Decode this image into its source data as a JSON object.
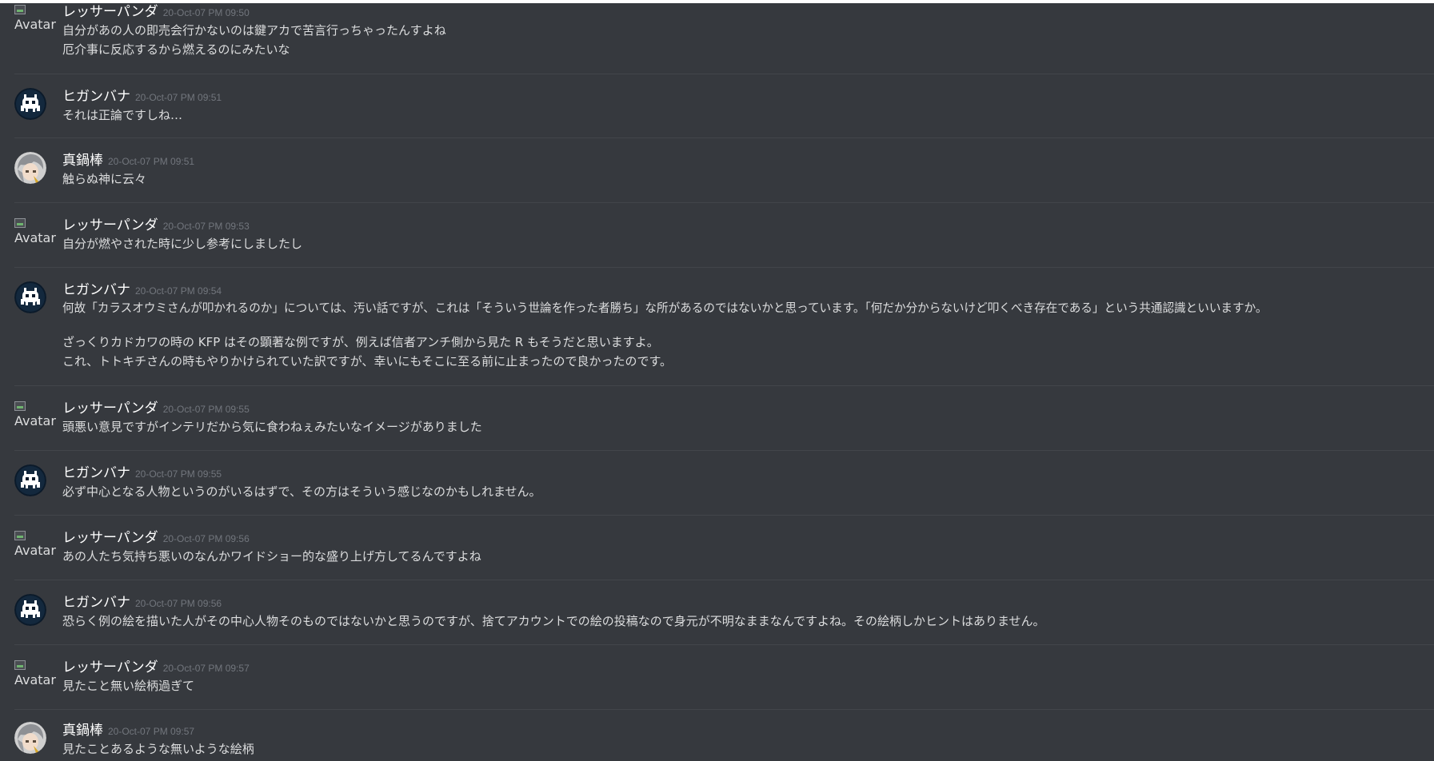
{
  "messages": [
    {
      "username": "レッサーパンダ",
      "timestamp": "20-Oct-07 PM 09:50",
      "avatar": {
        "type": "broken-image",
        "alt": "Avatar"
      },
      "lines": [
        "自分があの人の即売会行かないのは鍵アカで苦言行っちゃったんすよね",
        "厄介事に反応するから燃えるのにみたいな"
      ]
    },
    {
      "username": "ヒガンバナ",
      "timestamp": "20-Oct-07 PM 09:51",
      "avatar": {
        "type": "invader-icon"
      },
      "lines": [
        "それは正論ですしね…"
      ]
    },
    {
      "username": "真鍋棒",
      "timestamp": "20-Oct-07 PM 09:51",
      "avatar": {
        "type": "anime-avatar-icon"
      },
      "lines": [
        "触らぬ神に云々"
      ]
    },
    {
      "username": "レッサーパンダ",
      "timestamp": "20-Oct-07 PM 09:53",
      "avatar": {
        "type": "broken-image",
        "alt": "Avatar"
      },
      "lines": [
        "自分が燃やされた時に少し参考にしましたし"
      ]
    },
    {
      "username": "ヒガンバナ",
      "timestamp": "20-Oct-07 PM 09:54",
      "avatar": {
        "type": "invader-icon"
      },
      "lines": [
        "何故「カラスオウミさんが叩かれるのか」については、汚い話ですが、これは「そういう世論を作った者勝ち」な所があるのではないかと思っています。「何だか分からないけど叩くべき存在である」という共通認識といいますか。"
      ],
      "lines2": [
        "ざっくりカドカワの時の KFP はその顕著な例ですが、例えば信者アンチ側から見た R もそうだと思いますよ。",
        "これ、トトキチさんの時もやりかけられていた訳ですが、幸いにもそこに至る前に止まったので良かったのです。"
      ]
    },
    {
      "username": "レッサーパンダ",
      "timestamp": "20-Oct-07 PM 09:55",
      "avatar": {
        "type": "broken-image",
        "alt": "Avatar"
      },
      "lines": [
        "頭悪い意見ですがインテリだから気に食わねぇみたいなイメージがありました"
      ]
    },
    {
      "username": "ヒガンバナ",
      "timestamp": "20-Oct-07 PM 09:55",
      "avatar": {
        "type": "invader-icon"
      },
      "lines": [
        "必ず中心となる人物というのがいるはずで、その方はそういう感じなのかもしれません。"
      ]
    },
    {
      "username": "レッサーパンダ",
      "timestamp": "20-Oct-07 PM 09:56",
      "avatar": {
        "type": "broken-image",
        "alt": "Avatar"
      },
      "lines": [
        "あの人たち気持ち悪いのなんかワイドショー的な盛り上げ方してるんですよね"
      ]
    },
    {
      "username": "ヒガンバナ",
      "timestamp": "20-Oct-07 PM 09:56",
      "avatar": {
        "type": "invader-icon"
      },
      "lines": [
        "恐らく例の絵を描いた人がその中心人物そのものではないかと思うのですが、捨てアカウントでの絵の投稿なので身元が不明なままなんですよね。その絵柄しかヒントはありません。"
      ]
    },
    {
      "username": "レッサーパンダ",
      "timestamp": "20-Oct-07 PM 09:57",
      "avatar": {
        "type": "broken-image",
        "alt": "Avatar"
      },
      "lines": [
        "見たこと無い絵柄過ぎて"
      ]
    },
    {
      "username": "真鍋棒",
      "timestamp": "20-Oct-07 PM 09:57",
      "avatar": {
        "type": "anime-avatar-icon"
      },
      "lines": [
        "見たことあるような無いような絵柄"
      ]
    }
  ]
}
